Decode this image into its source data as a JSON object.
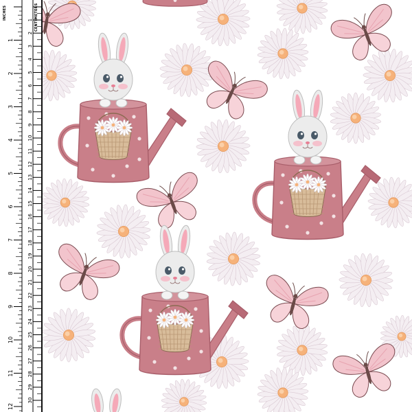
{
  "ruler": {
    "inches_label": "INCHES",
    "cm_label": "CENTIMETERS",
    "inch_numbers": [
      "1",
      "2",
      "3",
      "4",
      "5",
      "6",
      "7",
      "8",
      "9",
      "10",
      "11",
      "12"
    ],
    "cm_numbers": [
      "1",
      "2",
      "3",
      "4",
      "5",
      "6",
      "7",
      "8",
      "9",
      "10",
      "11",
      "12",
      "13",
      "14",
      "15",
      "16",
      "17",
      "18",
      "19",
      "20",
      "21",
      "22",
      "23",
      "24",
      "25",
      "26",
      "27",
      "28",
      "29",
      "30"
    ]
  },
  "colors": {
    "background": "#ffffff",
    "can_pink": "#c97f89",
    "can_dark": "#a85e6a",
    "butterfly_pink": "#f2c4cc",
    "daisy_petal": "#f4eef2",
    "daisy_center": "#f6b27a",
    "bunny_fur": "#ececec",
    "bunny_ear_inner": "#f5a9b8"
  },
  "motifs": {
    "bunnies": 4,
    "butterflies": 7,
    "daisies": 18
  }
}
